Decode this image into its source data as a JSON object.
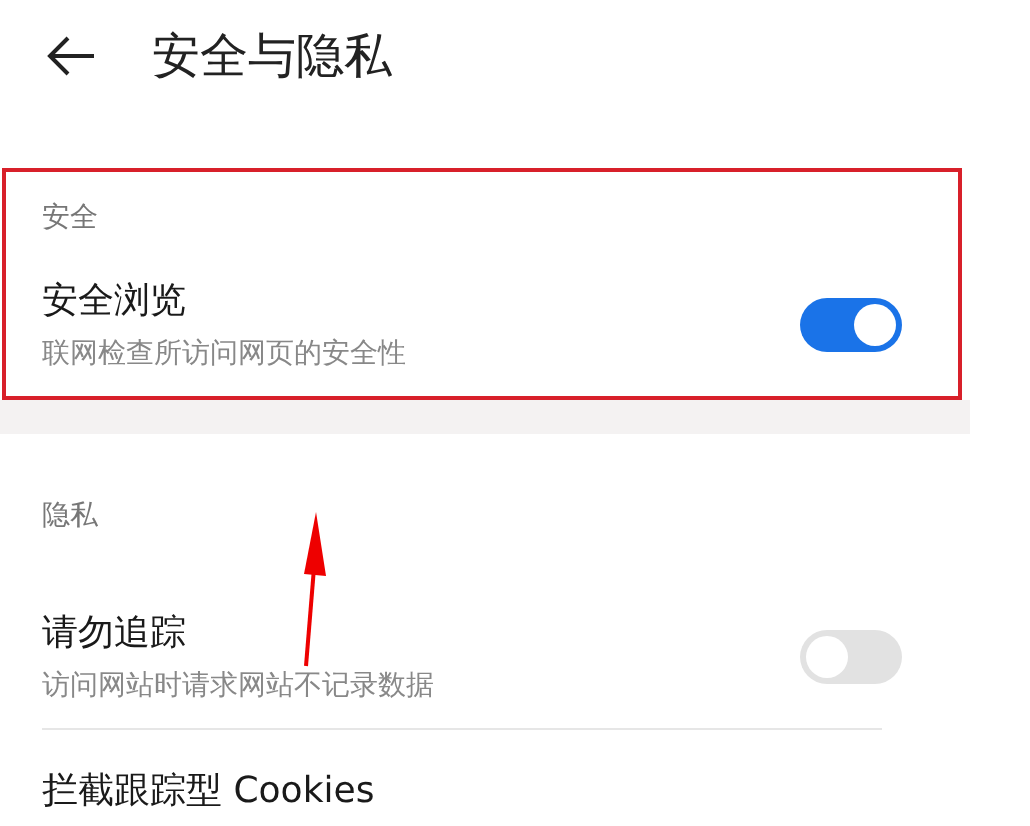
{
  "header": {
    "title": "安全与隐私"
  },
  "sections": [
    {
      "label": "安全",
      "highlighted": true,
      "items": [
        {
          "kind": "toggle",
          "title": "安全浏览",
          "description": "联网检查所访问网页的安全性",
          "on": true
        }
      ]
    },
    {
      "label": "隐私",
      "highlighted": false,
      "items": [
        {
          "kind": "toggle",
          "title": "请勿追踪",
          "description": "访问网站时请求网站不记录数据",
          "on": false
        },
        {
          "kind": "plain",
          "title": "拦截跟踪型 Cookies"
        }
      ]
    }
  ],
  "annotations": [
    {
      "kind": "arrow"
    }
  ]
}
